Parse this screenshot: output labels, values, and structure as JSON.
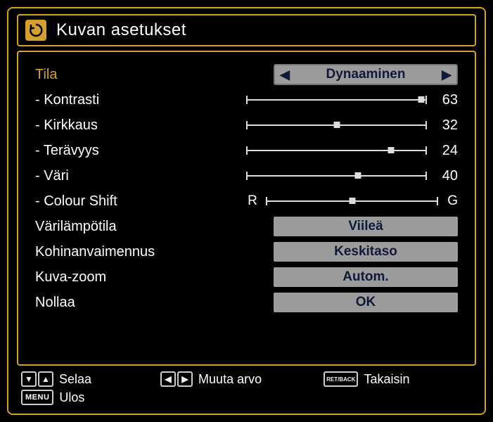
{
  "title": "Kuvan asetukset",
  "rows": {
    "mode": {
      "label": "Tila",
      "value": "Dynaaminen"
    },
    "contrast": {
      "label": "- Kontrasti",
      "value": 63,
      "pct": 97
    },
    "brightness": {
      "label": "- Kirkkaus",
      "value": 32,
      "pct": 50
    },
    "sharpness": {
      "label": "- Terävyys",
      "value": 24,
      "pct": 80
    },
    "colour": {
      "label": "- Väri",
      "value": 40,
      "pct": 62
    },
    "shift": {
      "label": "- Colour Shift",
      "left": "R",
      "right": "G",
      "pct": 50
    },
    "temp": {
      "label": "Värilämpötila",
      "value": "Viileä"
    },
    "noise": {
      "label": "Kohinanvaimennus",
      "value": "Keskitaso"
    },
    "zoom": {
      "label": "Kuva-zoom",
      "value": "Autom."
    },
    "reset": {
      "label": "Nollaa",
      "value": "OK"
    }
  },
  "footer": {
    "scroll": "Selaa",
    "change": "Muuta arvo",
    "back": "Takaisin",
    "back_key": "RET/BACK",
    "exit": "Ulos",
    "menu_key": "MENU"
  }
}
